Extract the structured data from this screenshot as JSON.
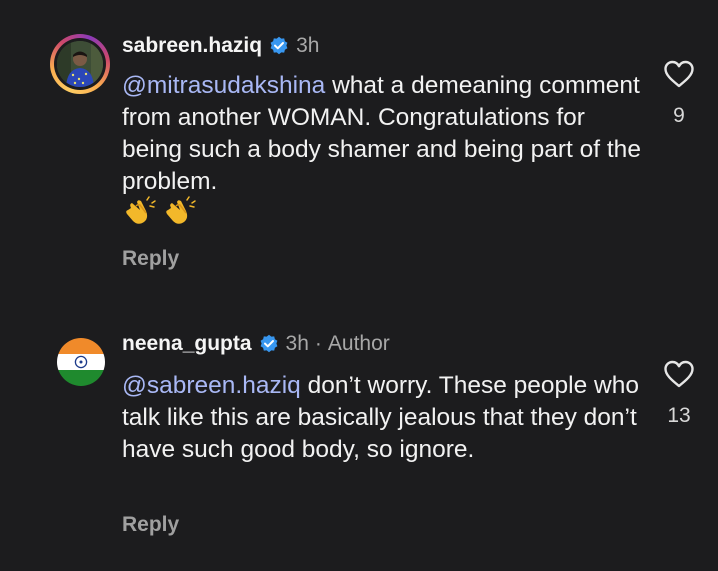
{
  "comments": [
    {
      "username": "sabreen.haziq",
      "time": "3h",
      "mention": "@mitrasudakshina",
      "text": " what a demeaning comment from another WOMAN. Congratulations for being such a body shamer and being part of the problem.",
      "emoji": [
        "👏",
        "👏"
      ],
      "reply_label": "Reply",
      "likes": "9"
    },
    {
      "username": "neena_gupta",
      "time": "3h",
      "separator": "·",
      "author_label": "Author",
      "mention": "@sabreen.haziq",
      "text": " don’t worry. These people who talk like this are basically jealous that they don’t have such good body, so ignore.",
      "reply_label": "Reply",
      "likes": "13"
    }
  ],
  "colors": {
    "background": "#1c1c1e",
    "mention": "#a9b8f5",
    "verified": "#3897f0",
    "muted": "#a8a8a8"
  },
  "icons": [
    "verified-badge-icon",
    "heart-outline-icon",
    "clapping-hands-emoji",
    "india-flag-avatar"
  ]
}
